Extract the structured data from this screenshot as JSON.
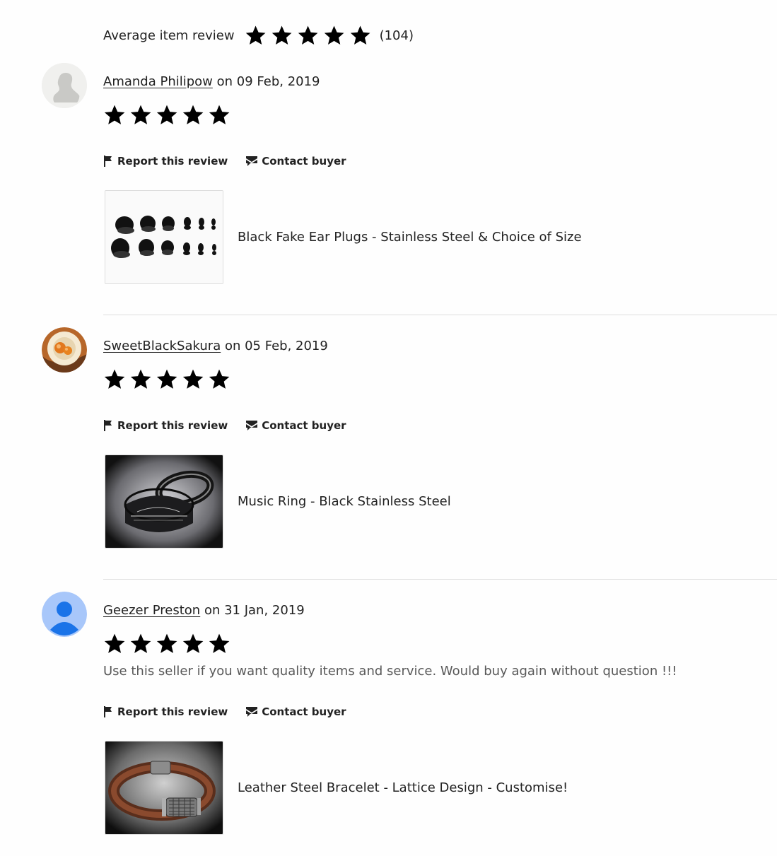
{
  "summary": {
    "label": "Average item review",
    "rating": 5,
    "count": "(104)"
  },
  "reviews": [
    {
      "name": "Amanda Philipow",
      "date": " on 09 Feb, 2019",
      "rating": 5,
      "text": "",
      "report_label": "Report this review",
      "contact_label": "Contact buyer",
      "product_title": "Black Fake Ear Plugs - Stainless Steel & Choice of Size"
    },
    {
      "name": "SweetBlackSakura",
      "date": " on 05 Feb, 2019",
      "rating": 5,
      "text": "",
      "report_label": "Report this review",
      "contact_label": "Contact buyer",
      "product_title": "Music Ring - Black Stainless Steel"
    },
    {
      "name": "Geezer Preston",
      "date": " on 31 Jan, 2019",
      "rating": 5,
      "text": "Use this seller if you want quality items and service. Would buy again without question !!!",
      "report_label": "Report this review",
      "contact_label": "Contact buyer",
      "product_title": "Leather Steel Bracelet - Lattice Design - Customise!"
    }
  ],
  "colors": {
    "text": "#222222",
    "divider": "#dddddd",
    "avatar_default_blue": "#a8c7fa",
    "avatar_default_figure": "#1a73e8"
  },
  "icons": [
    "star-icon",
    "flag-icon",
    "envelope-icon",
    "avatar-silhouette-icon"
  ]
}
